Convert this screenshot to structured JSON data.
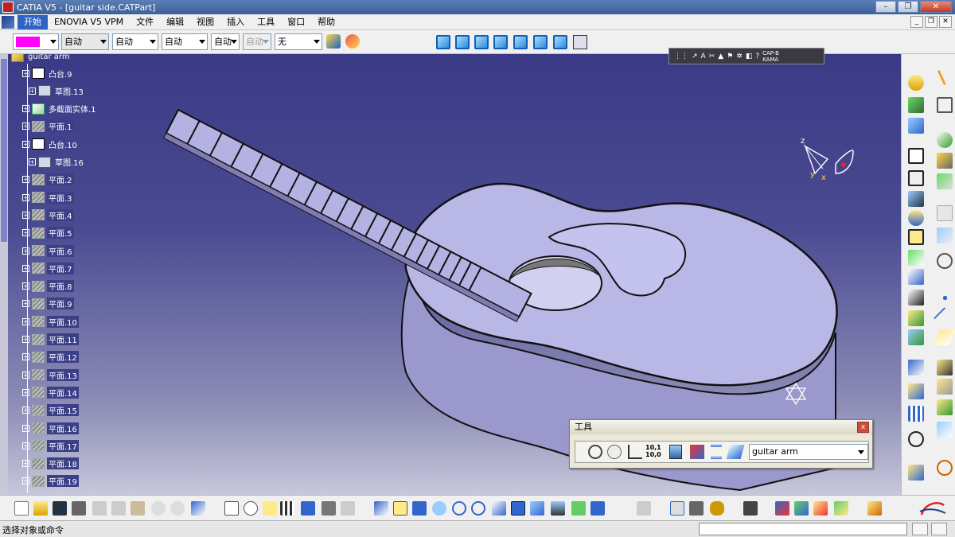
{
  "window": {
    "title": "CATIA V5 - [guitar side.CATPart]"
  },
  "menu": {
    "items": [
      "开始",
      "ENOVIA V5 VPM",
      "文件",
      "编辑",
      "视图",
      "插入",
      "工具",
      "窗口",
      "帮助"
    ]
  },
  "properties": {
    "color": "#ff00ff",
    "transparency": "自动",
    "line_thickness": "自动",
    "line_type": "自动",
    "point_type": "自动",
    "layer_disabled": "自动",
    "layer": "无"
  },
  "tree": {
    "root": "guitar arm",
    "items": [
      {
        "label": "凸台.9",
        "type": "pad",
        "level": 1
      },
      {
        "label": "草图.13",
        "type": "sketch",
        "level": 2
      },
      {
        "label": "多截面实体.1",
        "type": "multi",
        "level": 1
      },
      {
        "label": "平面.1",
        "type": "plane",
        "level": 1
      },
      {
        "label": "凸台.10",
        "type": "pad",
        "level": 1
      },
      {
        "label": "草图.16",
        "type": "sketch",
        "level": 2
      },
      {
        "label": "平面.2",
        "type": "plane",
        "level": 1
      },
      {
        "label": "平面.3",
        "type": "plane",
        "level": 1
      },
      {
        "label": "平面.4",
        "type": "plane",
        "level": 1
      },
      {
        "label": "平面.5",
        "type": "plane",
        "level": 1
      },
      {
        "label": "平面.6",
        "type": "plane",
        "level": 1
      },
      {
        "label": "平面.7",
        "type": "plane",
        "level": 1
      },
      {
        "label": "平面.8",
        "type": "plane",
        "level": 1
      },
      {
        "label": "平面.9",
        "type": "plane",
        "level": 1
      },
      {
        "label": "平面.10",
        "type": "plane",
        "level": 1
      },
      {
        "label": "平面.11",
        "type": "plane",
        "level": 1
      },
      {
        "label": "平面.12",
        "type": "plane",
        "level": 1
      },
      {
        "label": "平面.13",
        "type": "plane",
        "level": 1
      },
      {
        "label": "平面.14",
        "type": "plane",
        "level": 1
      },
      {
        "label": "平面.15",
        "type": "plane",
        "level": 1
      },
      {
        "label": "平面.16",
        "type": "plane",
        "level": 1
      },
      {
        "label": "平面.17",
        "type": "plane",
        "level": 1
      },
      {
        "label": "平面.18",
        "type": "plane",
        "level": 1
      },
      {
        "label": "平面.19",
        "type": "plane",
        "level": 1
      }
    ]
  },
  "tools_panel": {
    "title": "工具",
    "close": "x",
    "current_body": "guitar arm",
    "ruler_label_top": "10,1",
    "ruler_label_bottom": "10,0"
  },
  "mini_toolbar": {
    "label_top": "CAP-B",
    "label_bottom": "KAMA"
  },
  "axis": {
    "x": "x",
    "y": "y",
    "z": "z"
  },
  "status": {
    "message": "选择对象或命令"
  }
}
